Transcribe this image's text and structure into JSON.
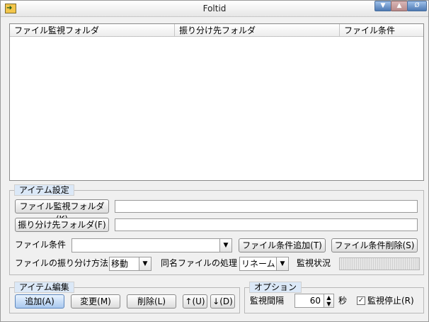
{
  "window": {
    "title": "Foltid",
    "controls": {
      "minimize": "▼",
      "maximize": "▲",
      "close": "Ø"
    }
  },
  "list": {
    "columns": [
      "ファイル監視フォルダ",
      "振り分け先フォルダ",
      "ファイル条件"
    ]
  },
  "item_settings": {
    "title": "アイテム設定",
    "watch_folder_button": "ファイル監視フォルダ(K)",
    "watch_folder_value": "",
    "dest_folder_button": "振り分け先フォルダ(F)",
    "dest_folder_value": "",
    "file_condition_label": "ファイル条件",
    "file_condition_value": "",
    "add_condition_button": "ファイル条件追加(T)",
    "delete_condition_button": "ファイル条件削除(S)",
    "sort_method_label": "ファイルの振り分け方法",
    "sort_method_value": "移動",
    "same_name_label": "同名ファイルの処理",
    "same_name_value": "リネーム",
    "monitor_status_label": "監視状況"
  },
  "item_edit": {
    "title": "アイテム編集",
    "add_button": "追加(A)",
    "change_button": "変更(M)",
    "delete_button": "削除(L)",
    "up_button": "↑(U)",
    "down_button": "↓(D)"
  },
  "options": {
    "title": "オプション",
    "interval_label": "監視間隔",
    "interval_value": "60",
    "interval_unit": "秒",
    "stop_label": "監視停止(R)",
    "stop_checked": true
  }
}
